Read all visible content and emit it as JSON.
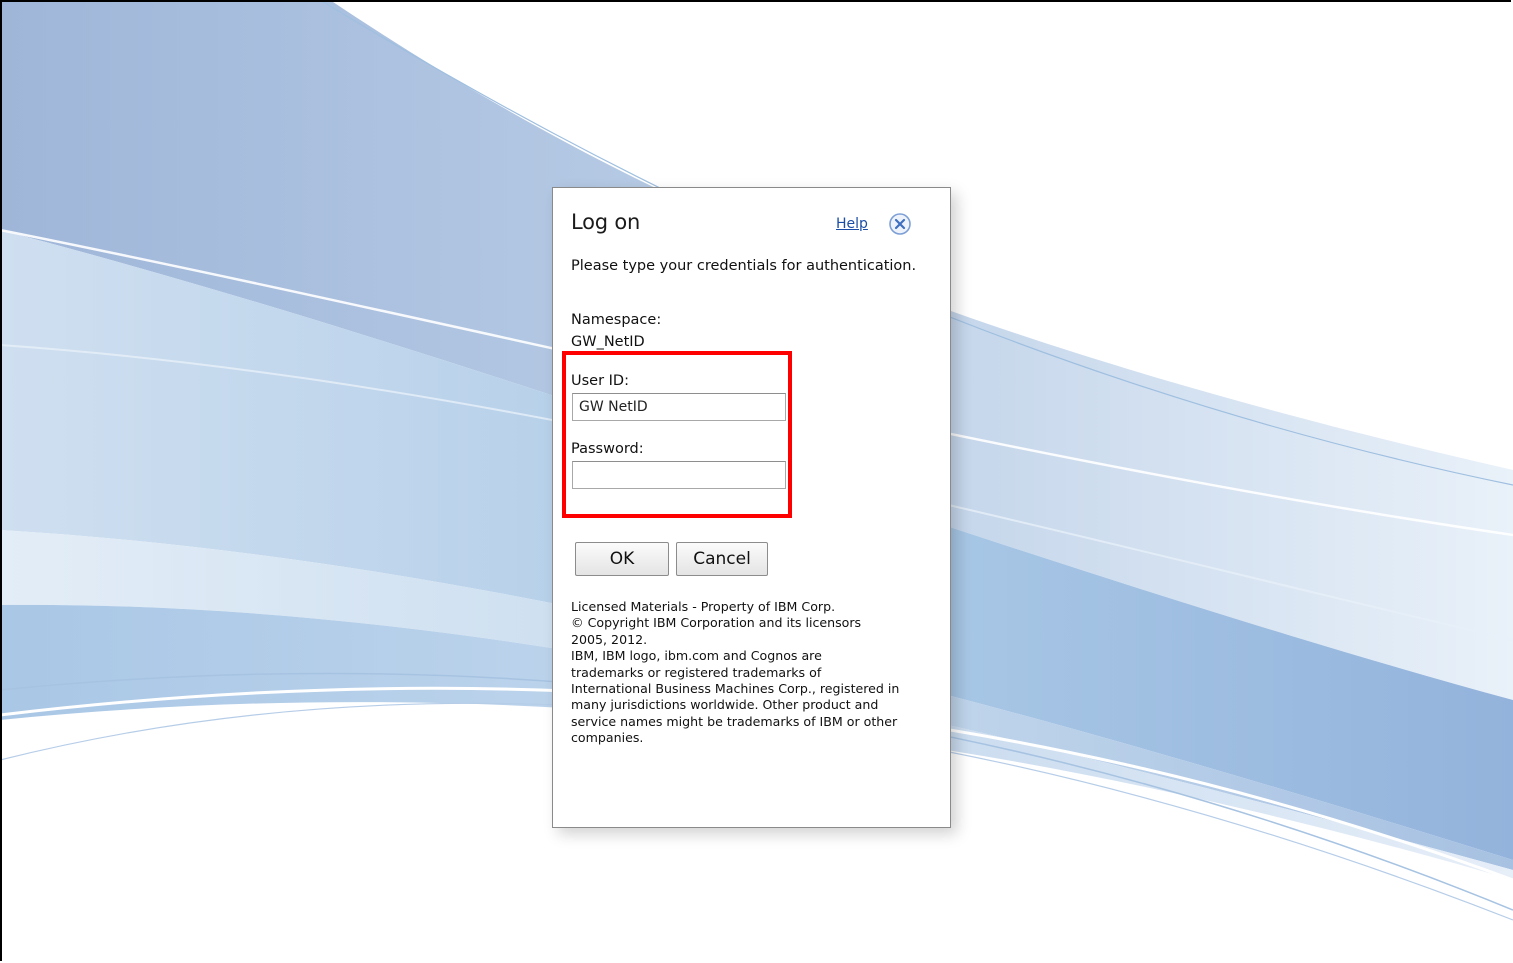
{
  "dialog": {
    "title": "Log on",
    "help_label": "Help",
    "close_icon": "close-circle-icon",
    "instruction": "Please type your credentials for authentication.",
    "namespace_label": "Namespace:",
    "namespace_value": "GW_NetID",
    "userid_label": "User ID:",
    "userid_value": "GW NetID",
    "password_label": "Password:",
    "password_value": "",
    "ok_label": "OK",
    "cancel_label": "Cancel",
    "legal_lines": [
      "Licensed Materials - Property of IBM Corp.",
      "© Copyright IBM Corporation and its licensors",
      "2005, 2012.",
      "IBM, IBM logo, ibm.com and Cognos are",
      "trademarks or registered trademarks of",
      "International Business Machines Corp., registered in",
      "many jurisdictions worldwide. Other product and",
      "service names might be trademarks of IBM or other",
      "companies."
    ]
  },
  "colors": {
    "link": "#1a4ea6",
    "highlight": "#ff0000",
    "wave_dark": "#8eaad3",
    "wave_light": "#c9dcef"
  }
}
